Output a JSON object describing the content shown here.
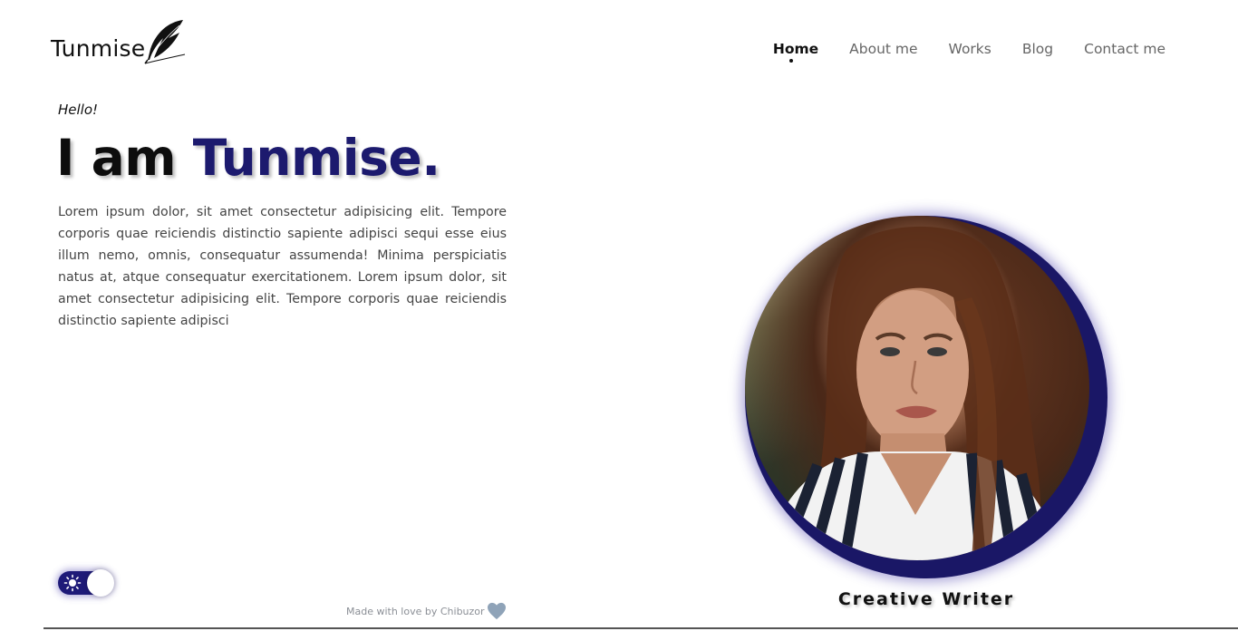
{
  "brand": {
    "name": "Tunmise"
  },
  "nav": {
    "items": [
      {
        "label": "Home",
        "active": true
      },
      {
        "label": "About me",
        "active": false
      },
      {
        "label": "Works",
        "active": false
      },
      {
        "label": "Blog",
        "active": false
      },
      {
        "label": "Contact me",
        "active": false
      }
    ]
  },
  "hero": {
    "greeting": "Hello!",
    "headline_prefix": "I am",
    "headline_name": "Tunmise.",
    "intro": "Lorem ipsum dolor, sit amet consectetur adipisicing elit. Tempore corporis quae reiciendis distinctio sapiente adipisci sequi esse eius illum nemo, omnis, consequatur assumenda! Minima perspiciatis natus at, atque consequatur exercitationem. Lorem ipsum dolor, sit amet consectetur adipisicing elit. Tempore corporis quae reiciendis distinctio sapiente adipisci"
  },
  "portrait": {
    "caption": "Creative Writer"
  },
  "theme_toggle": {
    "icon": "sun-icon",
    "state": "light"
  },
  "footer": {
    "text": "Made with love by Chibuzor",
    "icon": "heart-icon"
  },
  "colors": {
    "accent": "#1c1a6e",
    "toggle": "#1e1a78",
    "text_muted": "#666666",
    "heart": "#8fa3b8"
  }
}
